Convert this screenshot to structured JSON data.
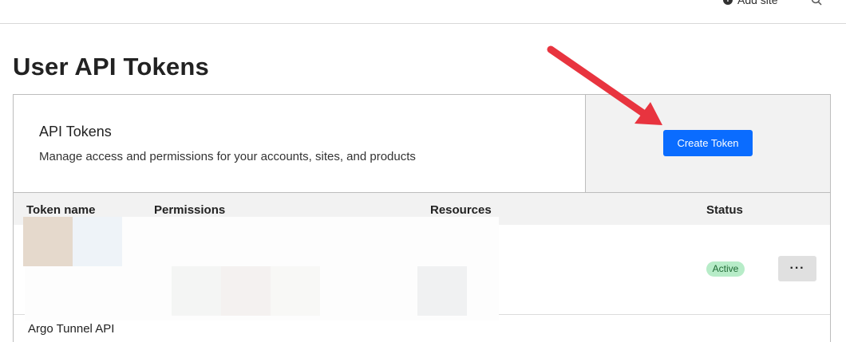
{
  "header": {
    "add_site_label": "Add site"
  },
  "page": {
    "title": "User API Tokens"
  },
  "card": {
    "title": "API Tokens",
    "description": "Manage access and permissions for your accounts, sites, and products",
    "create_button_label": "Create Token"
  },
  "table": {
    "columns": [
      "Token name",
      "Permissions",
      "Resources",
      "Status"
    ],
    "rows": [
      {
        "status": "Active",
        "menu_label": "···"
      },
      {
        "name": "Argo Tunnel API"
      }
    ]
  },
  "colors": {
    "accent": "#0a6cff",
    "status_active_bg": "#b7ecc8",
    "annotation_arrow": "#e8343f"
  },
  "icons": {
    "add_site": "plus-circle-icon",
    "search": "search-icon",
    "menu": "ellipsis-icon",
    "annotation": "arrow-annotation"
  }
}
